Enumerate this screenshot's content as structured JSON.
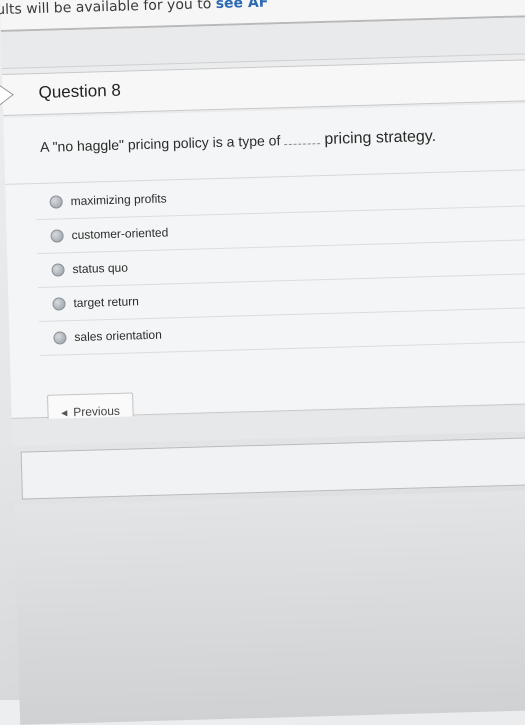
{
  "banner": {
    "text": "ults will be available  for you to ",
    "accent": "see AF"
  },
  "question": {
    "title": "Question 8",
    "prompt_start": "A \"no haggle\" pricing policy is a type of",
    "prompt_end": "pricing strategy.",
    "options": [
      "maximizing profits",
      "customer-oriented",
      "status quo",
      "target return",
      "sales orientation"
    ]
  },
  "navigation": {
    "previous_label": "Previous"
  },
  "icons": {
    "flag": "question-flag-icon",
    "radio": "radio-unselected-icon",
    "previous": "chevron-left-icon"
  },
  "colors": {
    "accent": "#2d68b3",
    "panel": "#f4f5f6",
    "border": "#c8c8c8"
  }
}
